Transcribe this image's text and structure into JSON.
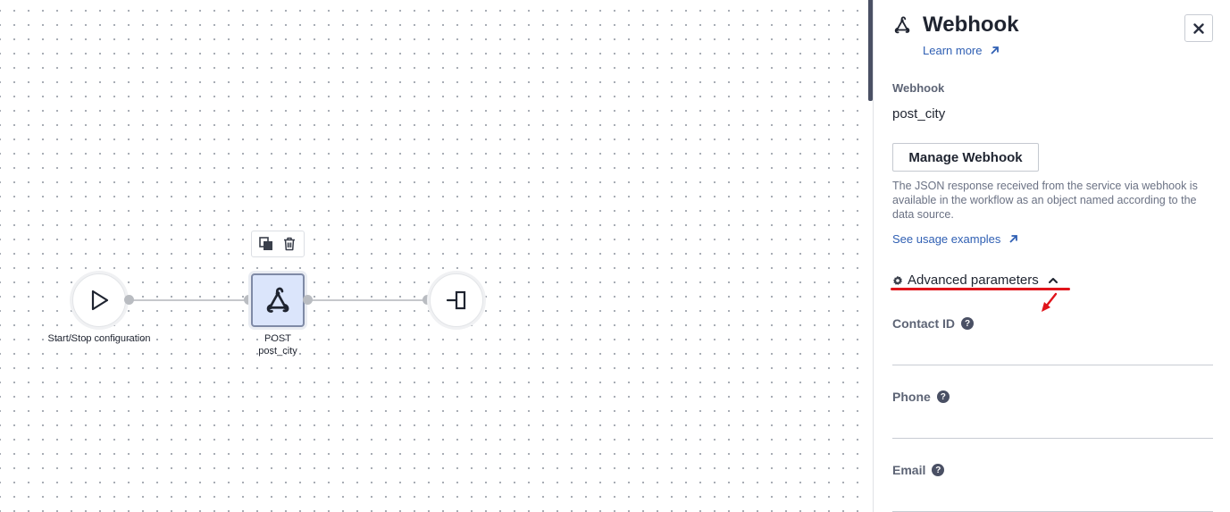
{
  "canvas": {
    "nodes": {
      "start": {
        "label": "Start/Stop configuration",
        "icon": "play-icon"
      },
      "webhook": {
        "method": "POST",
        "name": "post_city",
        "icon": "webhook-icon"
      },
      "end": {
        "icon": "exit-icon"
      }
    },
    "toolbar": {
      "copy_icon": "copy-icon",
      "delete_icon": "trash-icon"
    }
  },
  "panel": {
    "title": "Webhook",
    "title_icon": "webhook-icon",
    "learn_more": "Learn more",
    "webhook_label": "Webhook",
    "webhook_value": "post_city",
    "manage_button": "Manage Webhook",
    "description": "The JSON response received from the service via webhook is available in the workflow as an object named according to the data source.",
    "usage_link": "See usage examples",
    "advanced": {
      "label": "Advanced parameters",
      "expanded": true
    },
    "fields": [
      {
        "label": "Contact ID",
        "value": ""
      },
      {
        "label": "Phone",
        "value": ""
      },
      {
        "label": "Email",
        "value": ""
      }
    ]
  },
  "colors": {
    "accent": "#2f5fb3",
    "annotation": "#e0141b",
    "selected_node_fill": "#dbe5fb"
  }
}
